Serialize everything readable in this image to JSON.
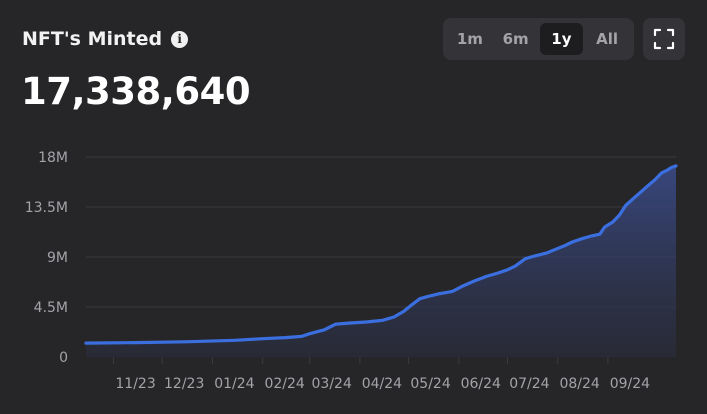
{
  "header": {
    "title": "NFT's Minted",
    "info_icon": "info-icon",
    "value": "17,338,640"
  },
  "range_buttons": [
    {
      "label": "1m",
      "active": false
    },
    {
      "label": "6m",
      "active": false
    },
    {
      "label": "1y",
      "active": true
    },
    {
      "label": "All",
      "active": false
    }
  ],
  "fullscreen_icon": "fullscreen-icon",
  "colors": {
    "background": "#262629",
    "line": "#3b6fe0",
    "grid": "#3a3a3f",
    "tick": "#a3a3a8"
  },
  "chart_data": {
    "type": "area",
    "title": "",
    "xlabel": "",
    "ylabel": "",
    "ylim": [
      0,
      18000000
    ],
    "y_ticks": [
      {
        "value": 0,
        "label": "0"
      },
      {
        "value": 4500000,
        "label": "4.5M"
      },
      {
        "value": 9000000,
        "label": "9M"
      },
      {
        "value": 13500000,
        "label": "13.5M"
      },
      {
        "value": 18000000,
        "label": "18M"
      }
    ],
    "x_ticks": [
      "11/23",
      "12/23",
      "01/24",
      "02/24",
      "03/24",
      "04/24",
      "05/24",
      "06/24",
      "07/24",
      "08/24",
      "09/24"
    ],
    "x_range": [
      "2023-10-15",
      "2024-10-13"
    ],
    "grid": true,
    "series": [
      {
        "points": [
          [
            "2023-10-15",
            1250000
          ],
          [
            "2023-11-15",
            1300000
          ],
          [
            "2023-12-15",
            1370000
          ],
          [
            "2024-01-15",
            1500000
          ],
          [
            "2024-02-01",
            1650000
          ],
          [
            "2024-02-15",
            1750000
          ],
          [
            "2024-02-25",
            1850000
          ],
          [
            "2024-03-01",
            2100000
          ],
          [
            "2024-03-10",
            2450000
          ],
          [
            "2024-03-17",
            2950000
          ],
          [
            "2024-03-25",
            3050000
          ],
          [
            "2024-04-05",
            3150000
          ],
          [
            "2024-04-15",
            3300000
          ],
          [
            "2024-04-22",
            3600000
          ],
          [
            "2024-04-28",
            4100000
          ],
          [
            "2024-05-03",
            4700000
          ],
          [
            "2024-05-08",
            5250000
          ],
          [
            "2024-05-13",
            5450000
          ],
          [
            "2024-05-20",
            5700000
          ],
          [
            "2024-05-28",
            5900000
          ],
          [
            "2024-06-03",
            6350000
          ],
          [
            "2024-06-10",
            6800000
          ],
          [
            "2024-06-18",
            7250000
          ],
          [
            "2024-06-25",
            7550000
          ],
          [
            "2024-07-01",
            7850000
          ],
          [
            "2024-07-06",
            8200000
          ],
          [
            "2024-07-12",
            8850000
          ],
          [
            "2024-07-18",
            9100000
          ],
          [
            "2024-07-25",
            9350000
          ],
          [
            "2024-07-30",
            9650000
          ],
          [
            "2024-08-05",
            10000000
          ],
          [
            "2024-08-10",
            10350000
          ],
          [
            "2024-08-16",
            10650000
          ],
          [
            "2024-08-22",
            10900000
          ],
          [
            "2024-08-27",
            11050000
          ],
          [
            "2024-08-30",
            11700000
          ],
          [
            "2024-09-04",
            12150000
          ],
          [
            "2024-09-08",
            12750000
          ],
          [
            "2024-09-12",
            13650000
          ],
          [
            "2024-09-17",
            14300000
          ],
          [
            "2024-09-22",
            14950000
          ],
          [
            "2024-09-26",
            15450000
          ],
          [
            "2024-09-30",
            15950000
          ],
          [
            "2024-10-04",
            16550000
          ],
          [
            "2024-10-08",
            16850000
          ],
          [
            "2024-10-10",
            17050000
          ],
          [
            "2024-10-13",
            17200000
          ]
        ]
      }
    ]
  }
}
